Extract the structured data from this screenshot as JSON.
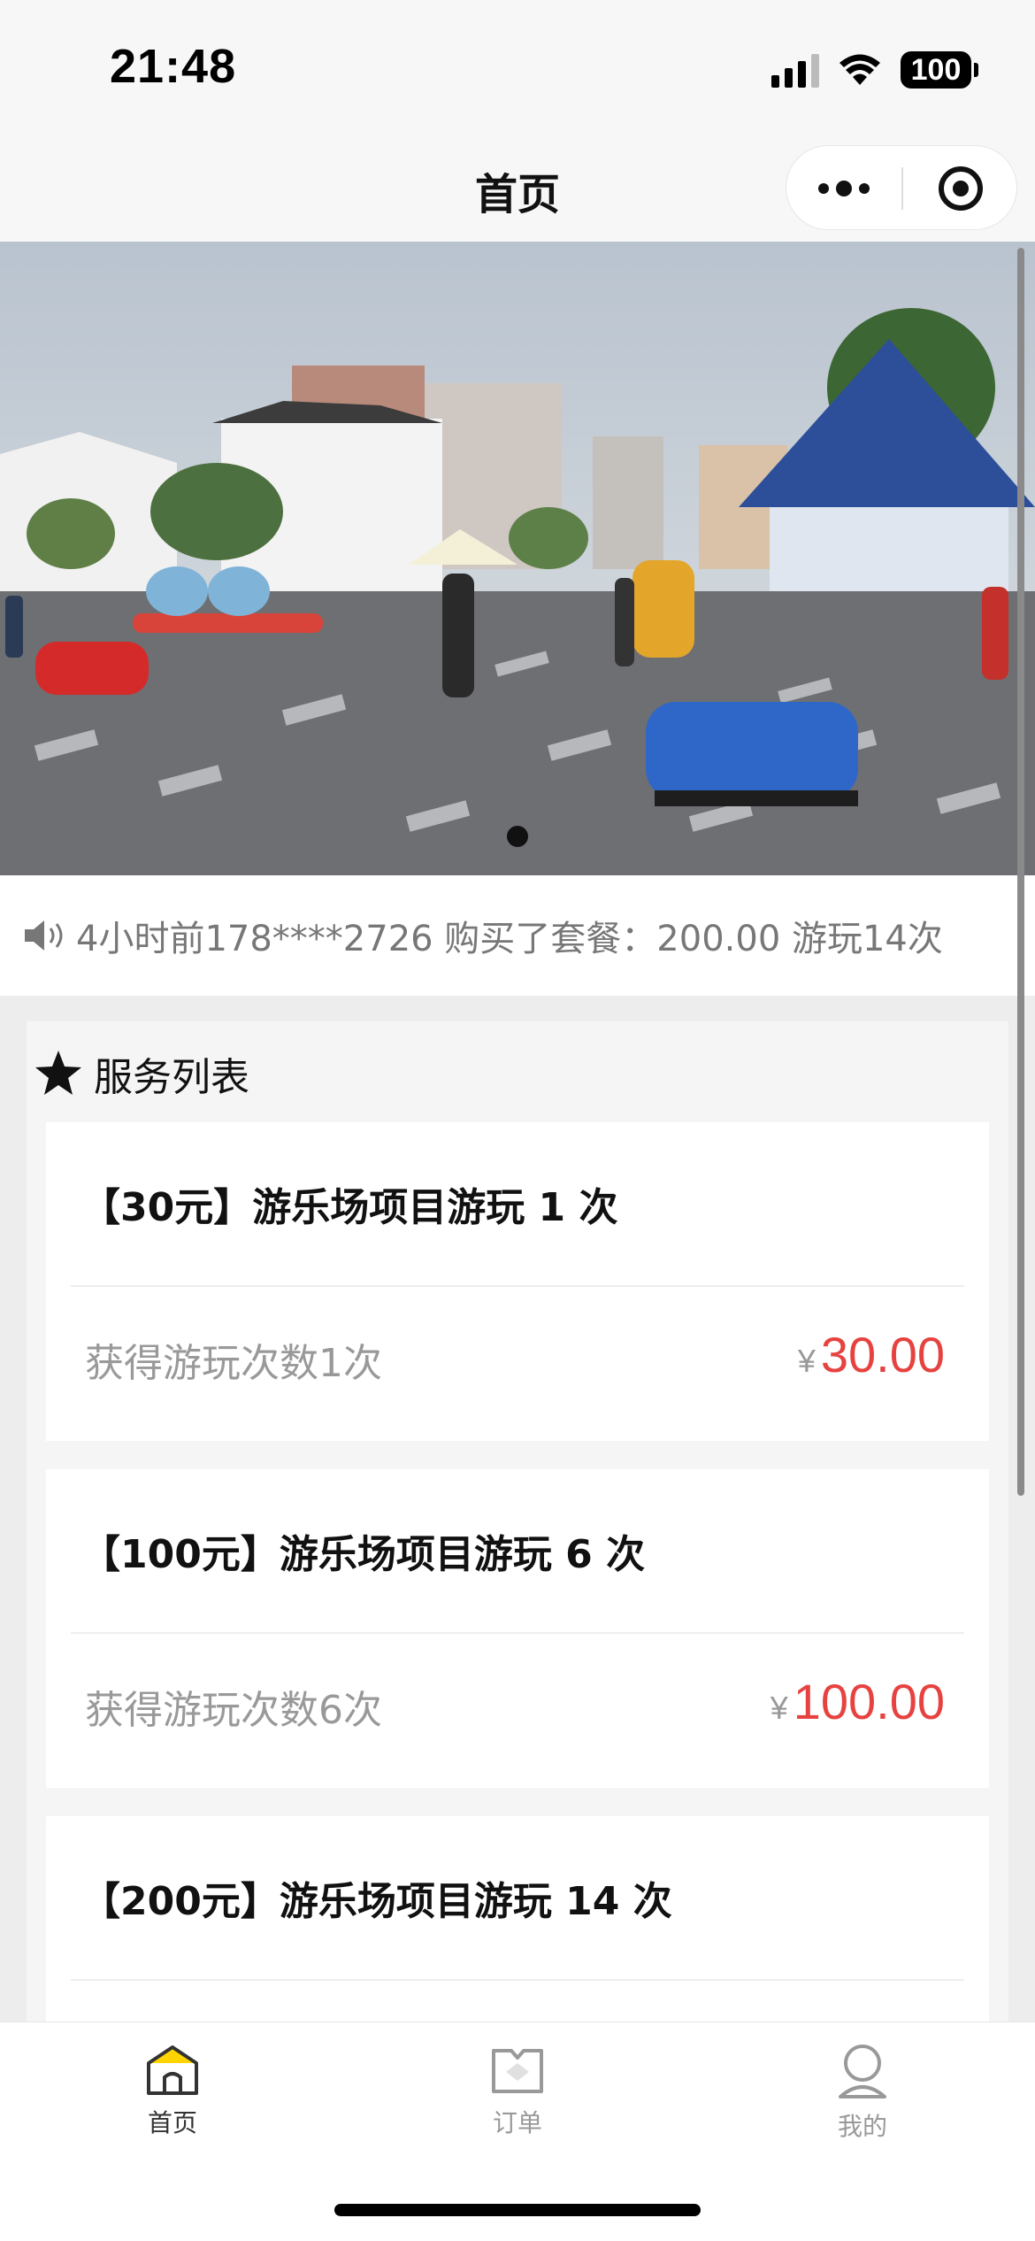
{
  "status_bar": {
    "time": "21:48",
    "battery": "100"
  },
  "nav": {
    "title": "首页",
    "more_icon": "more-dots-icon",
    "close_icon": "target-close-icon"
  },
  "banner": {
    "image": "amusement-park-square-photo",
    "active_index": 0,
    "count": 1
  },
  "notice": {
    "icon": "speaker-icon",
    "text": "4小时前178****2726 购买了套餐：200.00 游玩14次"
  },
  "services": {
    "icon": "star-icon",
    "title": "服务列表",
    "currency": "¥",
    "items": [
      {
        "title": "【30元】游乐场项目游玩 1 次",
        "desc": "获得游玩次数1次",
        "price": "30.00"
      },
      {
        "title": "【100元】游乐场项目游玩 6 次",
        "desc": "获得游玩次数6次",
        "price": "100.00"
      },
      {
        "title": "【200元】游乐场项目游玩 14 次",
        "desc": "",
        "price": ""
      }
    ]
  },
  "tabs": [
    {
      "label": "首页",
      "icon": "home-icon",
      "active": true
    },
    {
      "label": "订单",
      "icon": "order-icon",
      "active": false
    },
    {
      "label": "我的",
      "icon": "profile-icon",
      "active": false
    }
  ],
  "colors": {
    "price": "#e64340",
    "accent": "#ffd400",
    "background": "#ededed"
  }
}
